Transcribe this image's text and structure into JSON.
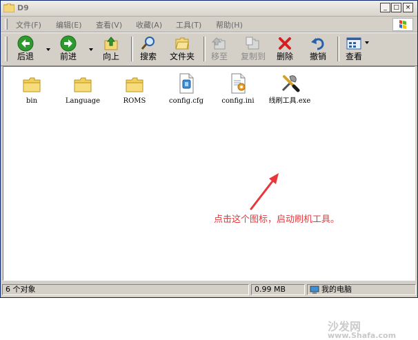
{
  "window": {
    "title": "D9"
  },
  "menu": [
    {
      "label": "文件(F)"
    },
    {
      "label": "编辑(E)"
    },
    {
      "label": "查看(V)"
    },
    {
      "label": "收藏(A)"
    },
    {
      "label": "工具(T)"
    },
    {
      "label": "帮助(H)"
    }
  ],
  "toolbar": {
    "back": "后退",
    "forward": "前进",
    "up": "向上",
    "search": "搜索",
    "folders": "文件夹",
    "move_to": "移至",
    "copy_to": "复制到",
    "delete": "删除",
    "undo": "撤销",
    "view": "查看"
  },
  "files": [
    {
      "name": "bin",
      "icon": "folder-icon"
    },
    {
      "name": "Language",
      "icon": "folder-icon"
    },
    {
      "name": "ROMS",
      "icon": "folder-icon"
    },
    {
      "name": "config.cfg",
      "icon": "cfg-file-icon"
    },
    {
      "name": "config.ini",
      "icon": "ini-file-icon"
    },
    {
      "name": "线刷工具.exe",
      "icon": "flash-tool-icon"
    }
  ],
  "annotation": "点击这个图标，启动刷机工具。",
  "status": {
    "objects": "6 个对象",
    "size": "0.99 MB",
    "location": "我的电脑"
  },
  "watermark": {
    "name": "沙发网",
    "url": "www.Shafa.com"
  },
  "colors": {
    "annotation": "#e8363a",
    "back_green": "#2e9a2e",
    "delete_red": "#d42020"
  }
}
